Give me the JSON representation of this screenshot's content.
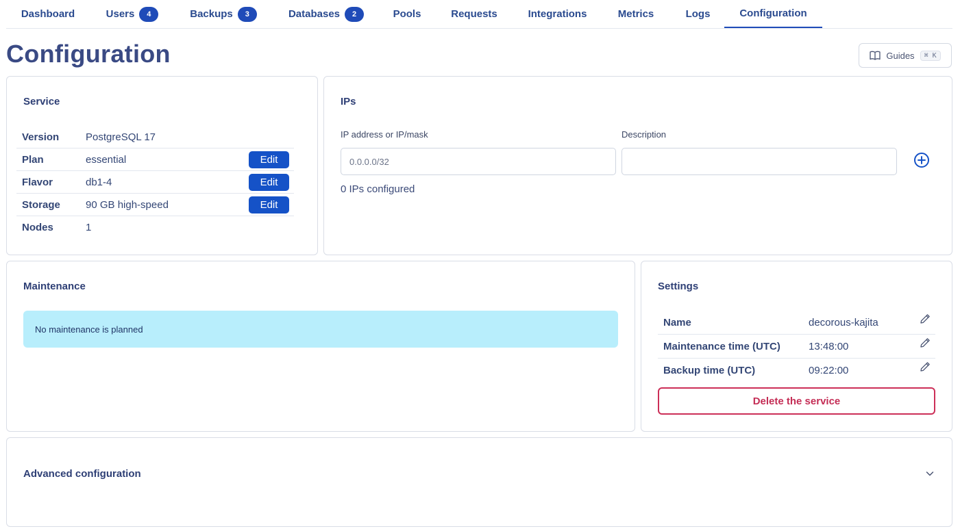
{
  "tabs": [
    {
      "label": "Dashboard",
      "badge": ""
    },
    {
      "label": "Users",
      "badge": "4"
    },
    {
      "label": "Backups",
      "badge": "3"
    },
    {
      "label": "Databases",
      "badge": "2"
    },
    {
      "label": "Pools",
      "badge": ""
    },
    {
      "label": "Requests",
      "badge": ""
    },
    {
      "label": "Integrations",
      "badge": ""
    },
    {
      "label": "Metrics",
      "badge": ""
    },
    {
      "label": "Logs",
      "badge": ""
    },
    {
      "label": "Configuration",
      "badge": "",
      "active": true
    }
  ],
  "page": {
    "title": "Configuration"
  },
  "guides": {
    "label": "Guides",
    "shortcut": "⌘ K",
    "icon": "book-icon"
  },
  "service": {
    "title": "Service",
    "rows": [
      {
        "label": "Version",
        "value": "PostgreSQL 17"
      },
      {
        "label": "Plan",
        "value": "essential",
        "action": "Edit"
      },
      {
        "label": "Flavor",
        "value": "db1-4",
        "action": "Edit"
      },
      {
        "label": "Storage",
        "value": "90 GB high-speed",
        "action": "Edit"
      },
      {
        "label": "Nodes",
        "value": "1"
      }
    ]
  },
  "ips": {
    "title": "IPs",
    "ip_label": "IP address or IP/mask",
    "ip_placeholder": "0.0.0.0/32",
    "desc_label": "Description",
    "desc_placeholder": "",
    "count_text": "0 IPs configured",
    "add_icon": "plus-circle-icon"
  },
  "maintenance": {
    "title": "Maintenance",
    "message": "No maintenance is planned"
  },
  "settings": {
    "title": "Settings",
    "rows": [
      {
        "label": "Name",
        "value": "decorous-kajita"
      },
      {
        "label": "Maintenance time (UTC)",
        "value": "13:48:00"
      },
      {
        "label": "Backup time (UTC)",
        "value": "09:22:00"
      }
    ],
    "edit_icon": "pencil-icon",
    "delete_label": "Delete the service"
  },
  "advanced": {
    "title": "Advanced configuration",
    "icon": "chevron-down-icon"
  },
  "colors": {
    "accent": "#1552c7",
    "danger": "#cc2e57",
    "info_bg": "#b8eefc",
    "title": "#3a4a84"
  }
}
